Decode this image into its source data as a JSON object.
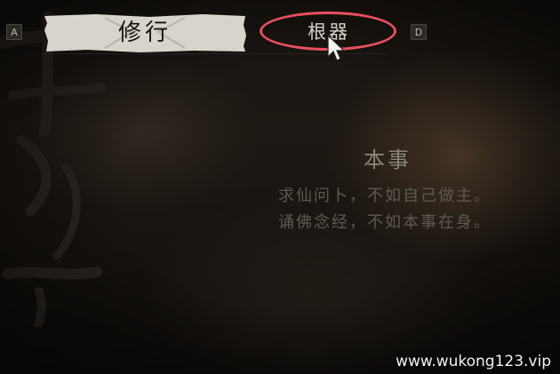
{
  "tabs": [
    {
      "label": "修行",
      "selected": true
    },
    {
      "label": "根器",
      "selected": false
    }
  ],
  "keys": {
    "prev": "A",
    "next": "D"
  },
  "content": {
    "title": "本事",
    "lines": [
      "求仙问卜，不如自己做主。",
      "诵佛念经，不如本事在身。"
    ]
  },
  "watermark": "www.wukong123.vip",
  "colors": {
    "highlight": "#e8505f",
    "active_tab_bg": "#d8d4cc",
    "text_dim": "#5d5850",
    "title_text": "#8a847b"
  },
  "icons": {
    "cursor": "mouse-pointer-icon",
    "highlight": "circle-highlight"
  }
}
